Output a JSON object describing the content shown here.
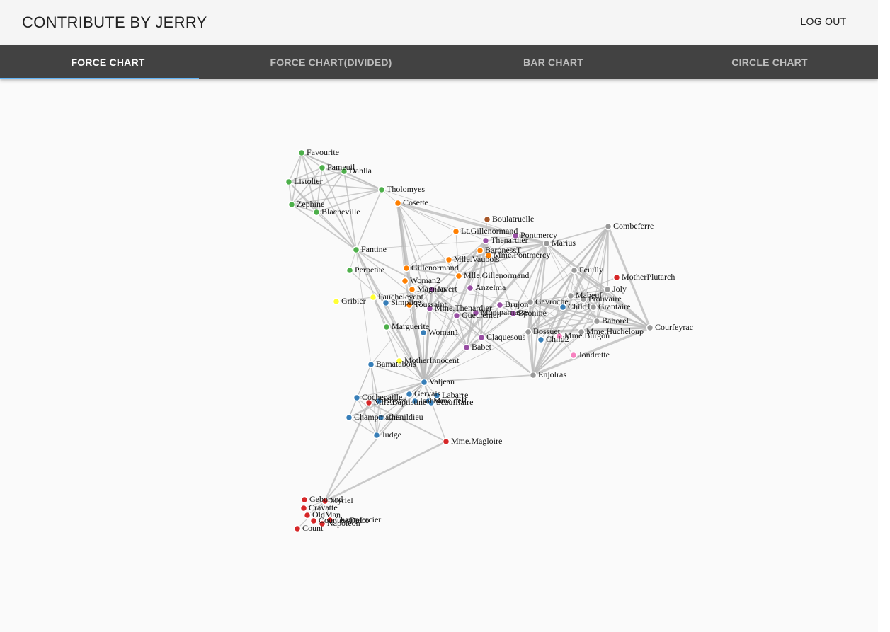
{
  "header": {
    "title": "CONTRIBUTE BY JERRY",
    "logout_label": "LOG OUT"
  },
  "tabs": [
    {
      "label": "FORCE CHART",
      "active": true
    },
    {
      "label": "FORCE CHART(DIVIDED)",
      "active": false
    },
    {
      "label": "BAR CHART",
      "active": false
    },
    {
      "label": "CIRCLE CHART",
      "active": false
    }
  ],
  "colors": {
    "tab_ink": "#64b5f6",
    "link": "#b9b9b9"
  },
  "group_colors": {
    "1": "#d62728",
    "2": "#ffff33",
    "3": "#4daf4a",
    "4": "#377eb8",
    "5": "#ff7f00",
    "6": "#984ea3",
    "7": "#a65628",
    "8": "#999999",
    "9": "#f781bf"
  },
  "chart_data": {
    "type": "force-directed network",
    "nodes": [
      {
        "name": "Myriel",
        "group": 1
      },
      {
        "name": "Napoleon",
        "group": 1
      },
      {
        "name": "Mlle.Baptistine",
        "group": 1
      },
      {
        "name": "Mme.Magloire",
        "group": 1
      },
      {
        "name": "CountessDeLo",
        "group": 1
      },
      {
        "name": "Geborand",
        "group": 1
      },
      {
        "name": "Champtercier",
        "group": 1
      },
      {
        "name": "Cravatte",
        "group": 1
      },
      {
        "name": "Count",
        "group": 1
      },
      {
        "name": "OldMan",
        "group": 1
      },
      {
        "name": "Labarre",
        "group": 4
      },
      {
        "name": "Valjean",
        "group": 4
      },
      {
        "name": "Marguerite",
        "group": 3
      },
      {
        "name": "Mme.deR",
        "group": 4
      },
      {
        "name": "Isabeau",
        "group": 4
      },
      {
        "name": "Gervais",
        "group": 4
      },
      {
        "name": "Tholomyes",
        "group": 3
      },
      {
        "name": "Listolier",
        "group": 3
      },
      {
        "name": "Fameuil",
        "group": 3
      },
      {
        "name": "Blacheville",
        "group": 3
      },
      {
        "name": "Favourite",
        "group": 3
      },
      {
        "name": "Dahlia",
        "group": 3
      },
      {
        "name": "Zephine",
        "group": 3
      },
      {
        "name": "Fantine",
        "group": 3
      },
      {
        "name": "Mme.Thenardier",
        "group": 6
      },
      {
        "name": "Thenardier",
        "group": 6
      },
      {
        "name": "Cosette",
        "group": 5
      },
      {
        "name": "Javert",
        "group": 6
      },
      {
        "name": "Fauchelevent",
        "group": 2
      },
      {
        "name": "Bamatabois",
        "group": 4
      },
      {
        "name": "Perpetue",
        "group": 3
      },
      {
        "name": "Simplice",
        "group": 4
      },
      {
        "name": "Scaufflaire",
        "group": 4
      },
      {
        "name": "Woman1",
        "group": 4
      },
      {
        "name": "Judge",
        "group": 4
      },
      {
        "name": "Champmathieu",
        "group": 4
      },
      {
        "name": "Brevet",
        "group": 4
      },
      {
        "name": "Chenildieu",
        "group": 4
      },
      {
        "name": "Cochepaille",
        "group": 4
      },
      {
        "name": "Pontmercy",
        "group": 6
      },
      {
        "name": "Boulatruelle",
        "group": 7
      },
      {
        "name": "Eponine",
        "group": 6
      },
      {
        "name": "Anzelma",
        "group": 6
      },
      {
        "name": "Woman2",
        "group": 5
      },
      {
        "name": "MotherInnocent",
        "group": 2
      },
      {
        "name": "Gribier",
        "group": 2
      },
      {
        "name": "Jondrette",
        "group": 9
      },
      {
        "name": "Mme.Burgon",
        "group": 9
      },
      {
        "name": "Gavroche",
        "group": 8
      },
      {
        "name": "Gillenormand",
        "group": 5
      },
      {
        "name": "Magnon",
        "group": 5
      },
      {
        "name": "Mlle.Gillenormand",
        "group": 5
      },
      {
        "name": "Mme.Pontmercy",
        "group": 5
      },
      {
        "name": "Mlle.Vaubois",
        "group": 5
      },
      {
        "name": "Lt.Gillenormand",
        "group": 5
      },
      {
        "name": "Marius",
        "group": 8
      },
      {
        "name": "BaronessT",
        "group": 5
      },
      {
        "name": "Mabeuf",
        "group": 8
      },
      {
        "name": "Enjolras",
        "group": 8
      },
      {
        "name": "Combeferre",
        "group": 8
      },
      {
        "name": "Prouvaire",
        "group": 8
      },
      {
        "name": "Feuilly",
        "group": 8
      },
      {
        "name": "Courfeyrac",
        "group": 8
      },
      {
        "name": "Bahorel",
        "group": 8
      },
      {
        "name": "Bossuet",
        "group": 8
      },
      {
        "name": "Joly",
        "group": 8
      },
      {
        "name": "Grantaire",
        "group": 8
      },
      {
        "name": "MotherPlutarch",
        "group": 1
      },
      {
        "name": "Gueulemer",
        "group": 6
      },
      {
        "name": "Babet",
        "group": 6
      },
      {
        "name": "Claquesous",
        "group": 6
      },
      {
        "name": "Montparnasse",
        "group": 6
      },
      {
        "name": "Toussaint",
        "group": 5
      },
      {
        "name": "Child1",
        "group": 4
      },
      {
        "name": "Child2",
        "group": 4
      },
      {
        "name": "Brujon",
        "group": 6
      },
      {
        "name": "Mme.Hucheloup",
        "group": 8
      }
    ],
    "links": [
      [
        1,
        0,
        1
      ],
      [
        2,
        0,
        8
      ],
      [
        3,
        0,
        10
      ],
      [
        3,
        2,
        6
      ],
      [
        4,
        0,
        1
      ],
      [
        5,
        0,
        1
      ],
      [
        6,
        0,
        1
      ],
      [
        7,
        0,
        1
      ],
      [
        8,
        0,
        2
      ],
      [
        9,
        0,
        1
      ],
      [
        11,
        10,
        1
      ],
      [
        11,
        3,
        3
      ],
      [
        11,
        2,
        3
      ],
      [
        11,
        0,
        5
      ],
      [
        12,
        11,
        1
      ],
      [
        13,
        11,
        1
      ],
      [
        14,
        11,
        1
      ],
      [
        15,
        11,
        1
      ],
      [
        17,
        16,
        4
      ],
      [
        18,
        16,
        4
      ],
      [
        18,
        17,
        4
      ],
      [
        19,
        16,
        4
      ],
      [
        19,
        17,
        4
      ],
      [
        19,
        18,
        4
      ],
      [
        20,
        16,
        3
      ],
      [
        20,
        17,
        3
      ],
      [
        20,
        18,
        3
      ],
      [
        20,
        19,
        4
      ],
      [
        21,
        16,
        3
      ],
      [
        21,
        17,
        3
      ],
      [
        21,
        18,
        3
      ],
      [
        21,
        19,
        3
      ],
      [
        21,
        20,
        5
      ],
      [
        22,
        16,
        3
      ],
      [
        22,
        17,
        3
      ],
      [
        22,
        18,
        3
      ],
      [
        22,
        19,
        3
      ],
      [
        22,
        20,
        4
      ],
      [
        22,
        21,
        4
      ],
      [
        23,
        16,
        3
      ],
      [
        23,
        17,
        3
      ],
      [
        23,
        18,
        3
      ],
      [
        23,
        19,
        3
      ],
      [
        23,
        20,
        4
      ],
      [
        23,
        21,
        4
      ],
      [
        23,
        22,
        4
      ],
      [
        23,
        12,
        2
      ],
      [
        23,
        11,
        9
      ],
      [
        24,
        23,
        2
      ],
      [
        24,
        11,
        7
      ],
      [
        25,
        24,
        13
      ],
      [
        25,
        23,
        1
      ],
      [
        25,
        11,
        12
      ],
      [
        26,
        24,
        4
      ],
      [
        26,
        11,
        31
      ],
      [
        26,
        16,
        1
      ],
      [
        26,
        25,
        1
      ],
      [
        27,
        11,
        17
      ],
      [
        27,
        23,
        5
      ],
      [
        27,
        25,
        5
      ],
      [
        27,
        24,
        1
      ],
      [
        27,
        26,
        1
      ],
      [
        28,
        11,
        8
      ],
      [
        28,
        27,
        1
      ],
      [
        29,
        23,
        1
      ],
      [
        29,
        27,
        1
      ],
      [
        29,
        11,
        2
      ],
      [
        30,
        23,
        1
      ],
      [
        31,
        30,
        2
      ],
      [
        31,
        11,
        3
      ],
      [
        31,
        23,
        2
      ],
      [
        31,
        27,
        1
      ],
      [
        32,
        11,
        1
      ],
      [
        33,
        11,
        2
      ],
      [
        33,
        27,
        1
      ],
      [
        34,
        11,
        3
      ],
      [
        34,
        29,
        2
      ],
      [
        35,
        11,
        3
      ],
      [
        35,
        34,
        3
      ],
      [
        35,
        29,
        2
      ],
      [
        36,
        34,
        2
      ],
      [
        36,
        35,
        2
      ],
      [
        36,
        11,
        2
      ],
      [
        36,
        29,
        1
      ],
      [
        37,
        34,
        2
      ],
      [
        37,
        35,
        2
      ],
      [
        37,
        36,
        2
      ],
      [
        37,
        11,
        2
      ],
      [
        37,
        29,
        1
      ],
      [
        38,
        34,
        2
      ],
      [
        38,
        35,
        2
      ],
      [
        38,
        36,
        2
      ],
      [
        38,
        37,
        2
      ],
      [
        38,
        11,
        2
      ],
      [
        38,
        29,
        1
      ],
      [
        39,
        25,
        1
      ],
      [
        40,
        25,
        1
      ],
      [
        41,
        24,
        2
      ],
      [
        41,
        25,
        3
      ],
      [
        42,
        41,
        2
      ],
      [
        42,
        25,
        2
      ],
      [
        42,
        24,
        1
      ],
      [
        43,
        11,
        3
      ],
      [
        43,
        26,
        1
      ],
      [
        43,
        27,
        1
      ],
      [
        44,
        28,
        3
      ],
      [
        44,
        11,
        1
      ],
      [
        45,
        28,
        2
      ],
      [
        47,
        46,
        1
      ],
      [
        48,
        47,
        2
      ],
      [
        48,
        25,
        1
      ],
      [
        48,
        27,
        1
      ],
      [
        48,
        11,
        1
      ],
      [
        49,
        26,
        3
      ],
      [
        49,
        11,
        2
      ],
      [
        50,
        49,
        1
      ],
      [
        50,
        24,
        1
      ],
      [
        51,
        49,
        9
      ],
      [
        51,
        26,
        2
      ],
      [
        51,
        11,
        2
      ],
      [
        52,
        51,
        1
      ],
      [
        52,
        39,
        1
      ],
      [
        53,
        51,
        1
      ],
      [
        54,
        51,
        2
      ],
      [
        54,
        49,
        1
      ],
      [
        54,
        26,
        1
      ],
      [
        55,
        51,
        6
      ],
      [
        55,
        49,
        12
      ],
      [
        55,
        39,
        1
      ],
      [
        55,
        54,
        1
      ],
      [
        55,
        26,
        21
      ],
      [
        55,
        11,
        19
      ],
      [
        55,
        16,
        1
      ],
      [
        55,
        25,
        2
      ],
      [
        55,
        41,
        5
      ],
      [
        55,
        48,
        4
      ],
      [
        56,
        49,
        1
      ],
      [
        56,
        55,
        1
      ],
      [
        57,
        55,
        1
      ],
      [
        57,
        41,
        1
      ],
      [
        57,
        48,
        1
      ],
      [
        58,
        55,
        7
      ],
      [
        58,
        48,
        7
      ],
      [
        58,
        27,
        6
      ],
      [
        58,
        57,
        1
      ],
      [
        58,
        11,
        4
      ],
      [
        59,
        58,
        15
      ],
      [
        59,
        55,
        5
      ],
      [
        59,
        48,
        6
      ],
      [
        59,
        57,
        2
      ],
      [
        60,
        48,
        1
      ],
      [
        60,
        58,
        4
      ],
      [
        60,
        59,
        2
      ],
      [
        61,
        48,
        2
      ],
      [
        61,
        58,
        6
      ],
      [
        61,
        60,
        2
      ],
      [
        61,
        59,
        5
      ],
      [
        61,
        57,
        1
      ],
      [
        61,
        55,
        1
      ],
      [
        62,
        55,
        9
      ],
      [
        62,
        58,
        17
      ],
      [
        62,
        59,
        13
      ],
      [
        62,
        48,
        7
      ],
      [
        62,
        57,
        2
      ],
      [
        62,
        41,
        1
      ],
      [
        62,
        61,
        6
      ],
      [
        62,
        60,
        3
      ],
      [
        63,
        59,
        5
      ],
      [
        63,
        48,
        5
      ],
      [
        63,
        62,
        6
      ],
      [
        63,
        57,
        2
      ],
      [
        63,
        58,
        4
      ],
      [
        63,
        61,
        3
      ],
      [
        63,
        60,
        2
      ],
      [
        63,
        55,
        1
      ],
      [
        64,
        55,
        5
      ],
      [
        64,
        62,
        12
      ],
      [
        64,
        48,
        5
      ],
      [
        64,
        63,
        4
      ],
      [
        64,
        58,
        10
      ],
      [
        64,
        61,
        6
      ],
      [
        64,
        60,
        2
      ],
      [
        64,
        59,
        9
      ],
      [
        64,
        57,
        1
      ],
      [
        64,
        11,
        1
      ],
      [
        65,
        63,
        5
      ],
      [
        65,
        64,
        7
      ],
      [
        65,
        48,
        3
      ],
      [
        65,
        62,
        5
      ],
      [
        65,
        58,
        5
      ],
      [
        65,
        61,
        5
      ],
      [
        65,
        60,
        2
      ],
      [
        65,
        59,
        5
      ],
      [
        65,
        57,
        1
      ],
      [
        65,
        55,
        2
      ],
      [
        66,
        64,
        3
      ],
      [
        66,
        58,
        3
      ],
      [
        66,
        59,
        1
      ],
      [
        66,
        62,
        2
      ],
      [
        66,
        65,
        2
      ],
      [
        66,
        48,
        1
      ],
      [
        66,
        63,
        1
      ],
      [
        66,
        61,
        1
      ],
      [
        66,
        60,
        1
      ],
      [
        67,
        57,
        3
      ],
      [
        68,
        25,
        5
      ],
      [
        68,
        11,
        1
      ],
      [
        68,
        24,
        1
      ],
      [
        68,
        27,
        1
      ],
      [
        68,
        48,
        1
      ],
      [
        68,
        41,
        1
      ],
      [
        69,
        25,
        6
      ],
      [
        69,
        68,
        6
      ],
      [
        69,
        11,
        1
      ],
      [
        69,
        24,
        1
      ],
      [
        69,
        27,
        2
      ],
      [
        69,
        48,
        1
      ],
      [
        69,
        41,
        1
      ],
      [
        70,
        25,
        4
      ],
      [
        70,
        69,
        4
      ],
      [
        70,
        68,
        4
      ],
      [
        70,
        11,
        1
      ],
      [
        70,
        24,
        1
      ],
      [
        70,
        27,
        1
      ],
      [
        70,
        41,
        1
      ],
      [
        70,
        58,
        1
      ],
      [
        71,
        27,
        1
      ],
      [
        71,
        69,
        2
      ],
      [
        71,
        68,
        2
      ],
      [
        71,
        70,
        2
      ],
      [
        71,
        11,
        1
      ],
      [
        71,
        48,
        1
      ],
      [
        71,
        41,
        1
      ],
      [
        71,
        25,
        1
      ],
      [
        72,
        26,
        2
      ],
      [
        72,
        27,
        1
      ],
      [
        72,
        11,
        1
      ],
      [
        73,
        48,
        2
      ],
      [
        74,
        48,
        2
      ],
      [
        74,
        73,
        3
      ],
      [
        75,
        69,
        3
      ],
      [
        75,
        68,
        3
      ],
      [
        75,
        25,
        3
      ],
      [
        75,
        48,
        1
      ],
      [
        75,
        41,
        1
      ],
      [
        75,
        70,
        1
      ],
      [
        75,
        71,
        1
      ],
      [
        76,
        64,
        1
      ],
      [
        76,
        65,
        1
      ],
      [
        76,
        66,
        1
      ],
      [
        76,
        63,
        1
      ],
      [
        76,
        62,
        1
      ],
      [
        76,
        48,
        1
      ],
      [
        76,
        58,
        1
      ]
    ]
  }
}
